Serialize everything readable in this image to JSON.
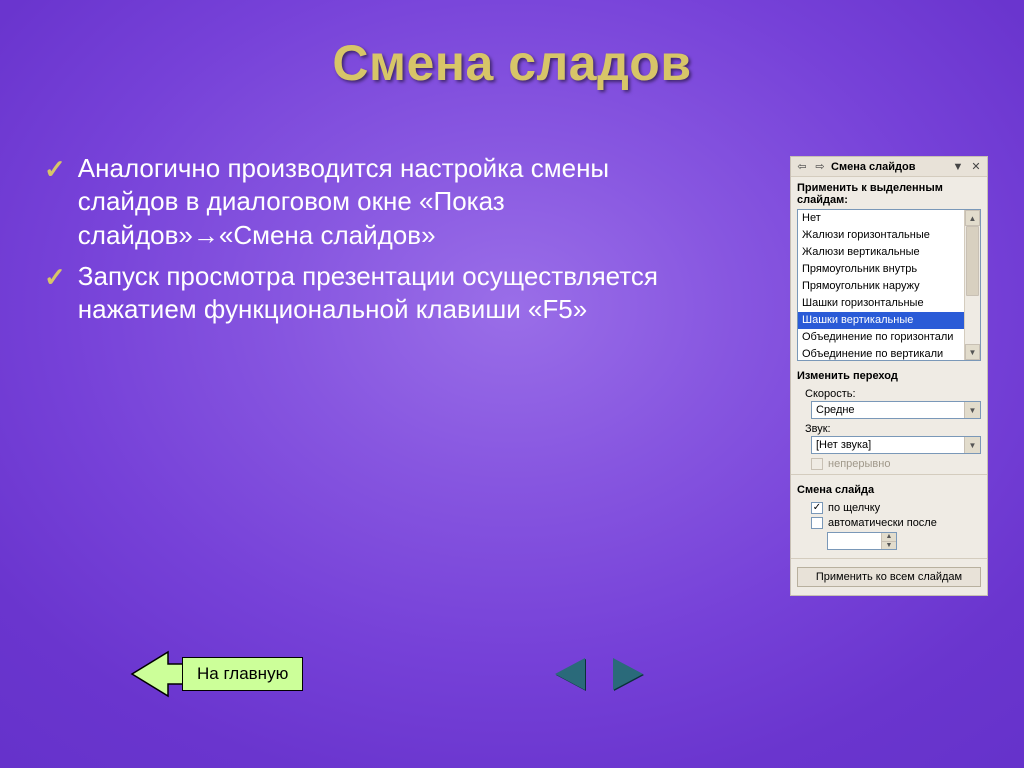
{
  "title": "Смена сладов",
  "bullets": [
    "Аналогично производится настройка смены слайдов в диалоговом окне «Показ слайдов»→«Смена слайдов»",
    "Запуск просмотра презентации осуществляется нажатием функциональной клавиши «F5»"
  ],
  "nav": {
    "home": "На главную"
  },
  "panel": {
    "title": "Смена слайдов",
    "apply_to": "Применить к выделенным слайдам:",
    "list": {
      "items": [
        "Нет",
        "Жалюзи горизонтальные",
        "Жалюзи вертикальные",
        "Прямоугольник внутрь",
        "Прямоугольник наружу",
        "Шашки горизонтальные",
        "Шашки вертикальные",
        "Объединение по горизонтали",
        "Объединение по вертикали"
      ],
      "selected_index": 6
    },
    "transition": {
      "heading": "Изменить переход",
      "speed_label": "Скорость:",
      "speed_value": "Средне",
      "sound_label": "Звук:",
      "sound_value": "[Нет звука]",
      "loop_label": "непрерывно"
    },
    "advance": {
      "heading": "Смена слайда",
      "on_click": "по щелчку",
      "auto_after": "автоматически после"
    },
    "apply_all": "Применить ко всем слайдам"
  }
}
